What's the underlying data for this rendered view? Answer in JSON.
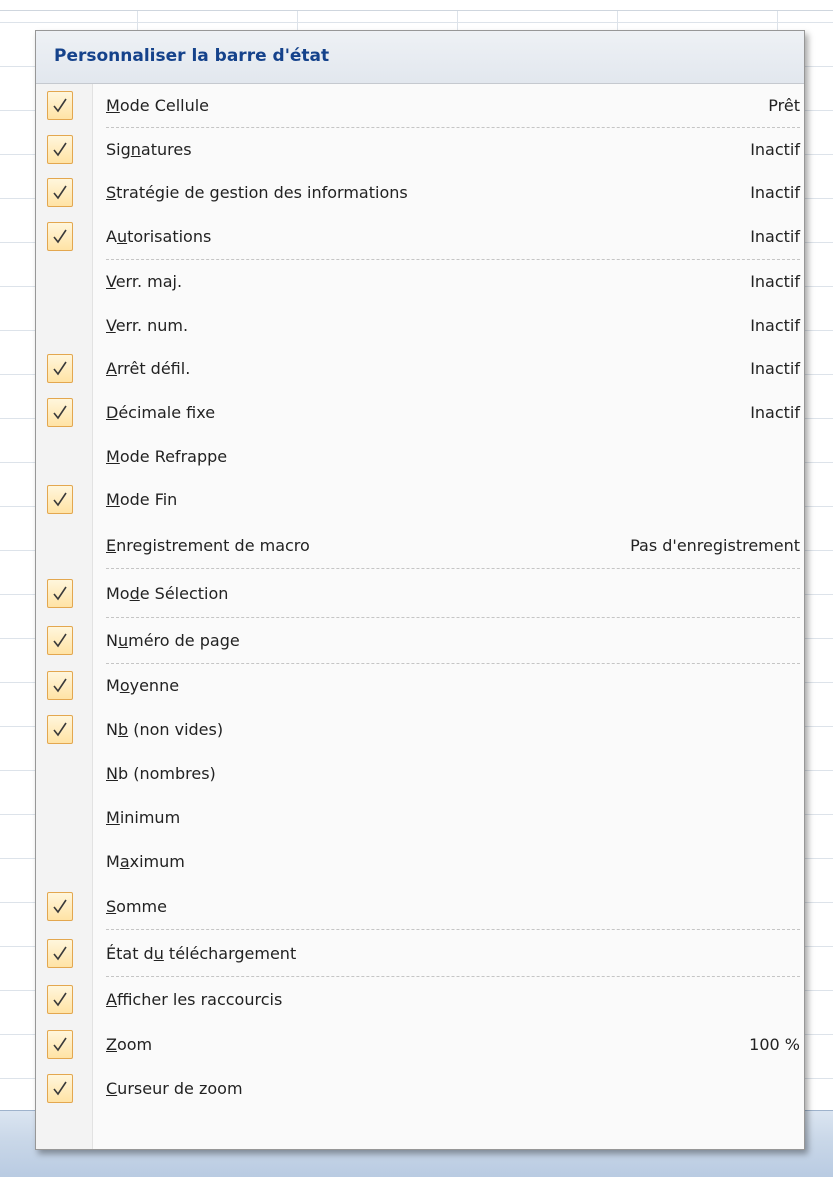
{
  "menu": {
    "title": "Personnaliser la barre d'état",
    "items": [
      {
        "pre": "",
        "acc": "M",
        "post": "ode Cellule",
        "value": "Prêt",
        "checked": true,
        "sep": true
      },
      {
        "pre": "Sig",
        "acc": "n",
        "post": "atures",
        "value": "Inactif",
        "checked": true,
        "sep": false
      },
      {
        "pre": "",
        "acc": "S",
        "post": "tratégie de gestion des informations",
        "value": "Inactif",
        "checked": true,
        "sep": false
      },
      {
        "pre": "A",
        "acc": "u",
        "post": "torisations",
        "value": "Inactif",
        "checked": true,
        "sep": true
      },
      {
        "pre": "",
        "acc": "V",
        "post": "err. maj.",
        "value": "Inactif",
        "checked": false,
        "sep": false
      },
      {
        "pre": "",
        "acc": "V",
        "post": "err. num.",
        "value": "Inactif",
        "checked": false,
        "sep": false
      },
      {
        "pre": "",
        "acc": "A",
        "post": "rrêt défil.",
        "value": "Inactif",
        "checked": true,
        "sep": false
      },
      {
        "pre": "",
        "acc": "D",
        "post": "écimale fixe",
        "value": "Inactif",
        "checked": true,
        "sep": false
      },
      {
        "pre": "",
        "acc": "M",
        "post": "ode Refrappe",
        "value": "",
        "checked": false,
        "sep": false
      },
      {
        "pre": "",
        "acc": "M",
        "post": "ode Fin",
        "value": "",
        "checked": true,
        "sep": false
      },
      {
        "pre": "",
        "acc": "E",
        "post": "nregistrement de macro",
        "value": "Pas d'enregistrement",
        "checked": false,
        "sep": true
      },
      {
        "pre": "Mo",
        "acc": "d",
        "post": "e Sélection",
        "value": "",
        "checked": true,
        "sep": true
      },
      {
        "pre": "N",
        "acc": "u",
        "post": "méro de page",
        "value": "",
        "checked": true,
        "sep": true
      },
      {
        "pre": "M",
        "acc": "o",
        "post": "yenne",
        "value": "",
        "checked": true,
        "sep": false
      },
      {
        "pre": "N",
        "acc": "b",
        "post": " (non vides)",
        "value": "",
        "checked": true,
        "sep": false
      },
      {
        "pre": "",
        "acc": "N",
        "post": "b (nombres)",
        "value": "",
        "checked": false,
        "sep": false
      },
      {
        "pre": "",
        "acc": "M",
        "post": "inimum",
        "value": "",
        "checked": false,
        "sep": false
      },
      {
        "pre": "M",
        "acc": "a",
        "post": "ximum",
        "value": "",
        "checked": false,
        "sep": false
      },
      {
        "pre": "",
        "acc": "S",
        "post": "omme",
        "value": "",
        "checked": true,
        "sep": true
      },
      {
        "pre": "État d",
        "acc": "u",
        "post": " téléchargement",
        "value": "",
        "checked": true,
        "sep": true
      },
      {
        "pre": "",
        "acc": "A",
        "post": "fficher les raccourcis",
        "value": "",
        "checked": true,
        "sep": false
      },
      {
        "pre": "",
        "acc": "Z",
        "post": "oom",
        "value": "100 %",
        "checked": true,
        "sep": false
      },
      {
        "pre": "",
        "acc": "C",
        "post": "urseur de zoom",
        "value": "",
        "checked": true,
        "sep": false
      }
    ]
  },
  "icons": {
    "check": "checkmark-icon"
  },
  "colors": {
    "title": "#15428b",
    "check_border": "#e3a74f",
    "check_fill": "#ffe3a5"
  }
}
